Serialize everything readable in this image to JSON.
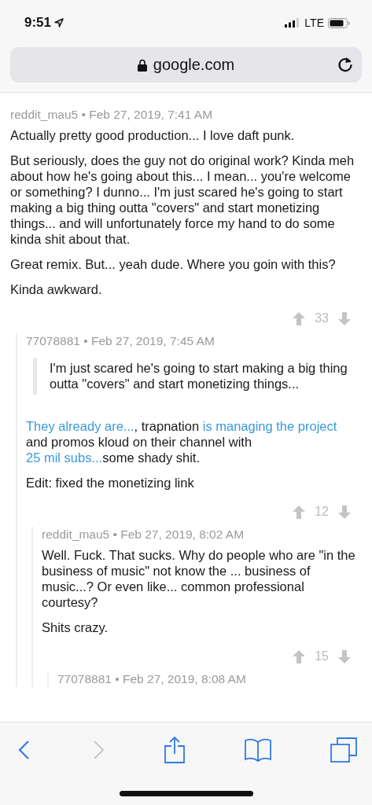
{
  "status_bar": {
    "time": "9:51",
    "network": "LTE"
  },
  "address_bar": {
    "url": "google.com",
    "secure": true
  },
  "comments": [
    {
      "byline": "reddit_mau5 • Feb 27, 2019, 7:41 AM",
      "paragraphs": [
        {
          "kind": "text",
          "segments": [
            {
              "text": "Actually pretty good production... I love daft punk.",
              "link": false
            }
          ]
        },
        {
          "kind": "text",
          "segments": [
            {
              "text": "But seriously, does the guy not do original work? Kinda meh about how he's going about this... I mean... you're welcome or something? I dunno... I'm just scared he's going to start making a big thing outta \"covers\" and start monetizing things... and will unfortunately force my hand to do some kinda shit about that.",
              "link": false
            }
          ]
        },
        {
          "kind": "text",
          "segments": [
            {
              "text": "Great remix. But... yeah dude. Where you goin with this?",
              "link": false
            }
          ]
        },
        {
          "kind": "text",
          "segments": [
            {
              "text": "Kinda awkward.",
              "link": false
            }
          ]
        }
      ],
      "votes": "33",
      "children": [
        {
          "byline": "77078881 • Feb 27, 2019, 7:45 AM",
          "paragraphs": [
            {
              "kind": "quote",
              "segments": [
                {
                  "text": "I'm just scared he's going to start making a big thing outta \"covers\" and start monetizing things...",
                  "link": false
                }
              ]
            },
            {
              "kind": "text",
              "segments": [
                {
                  "text": "They already are...",
                  "link": true
                },
                {
                  "text": ", trapnation ",
                  "link": false
                },
                {
                  "text": "is managing the project",
                  "link": true
                },
                {
                  "text": " and promos kloud on their channel with ",
                  "link": false
                },
                {
                  "text": "25 mil subs...",
                  "link": true
                },
                {
                  "text": "some shady shit.",
                  "link": false
                }
              ]
            },
            {
              "kind": "text",
              "segments": [
                {
                  "text": "Edit: fixed the monetizing link",
                  "link": false
                }
              ]
            }
          ],
          "votes": "12",
          "children": [
            {
              "byline": "reddit_mau5 • Feb 27, 2019, 8:02 AM",
              "paragraphs": [
                {
                  "kind": "text",
                  "segments": [
                    {
                      "text": "Well. Fuck. That sucks. Why do people who are \"in the business of music\" not know the ... business of music...? Or even like... common professional courtesy?",
                      "link": false
                    }
                  ]
                },
                {
                  "kind": "text",
                  "segments": [
                    {
                      "text": "Shits crazy.",
                      "link": false
                    }
                  ]
                }
              ],
              "votes": "15",
              "children": [
                {
                  "byline": "77078881 • Feb 27, 2019, 8:08 AM"
                }
              ]
            }
          ]
        }
      ]
    }
  ],
  "toolbar": {
    "back_enabled": true,
    "forward_enabled": false
  }
}
